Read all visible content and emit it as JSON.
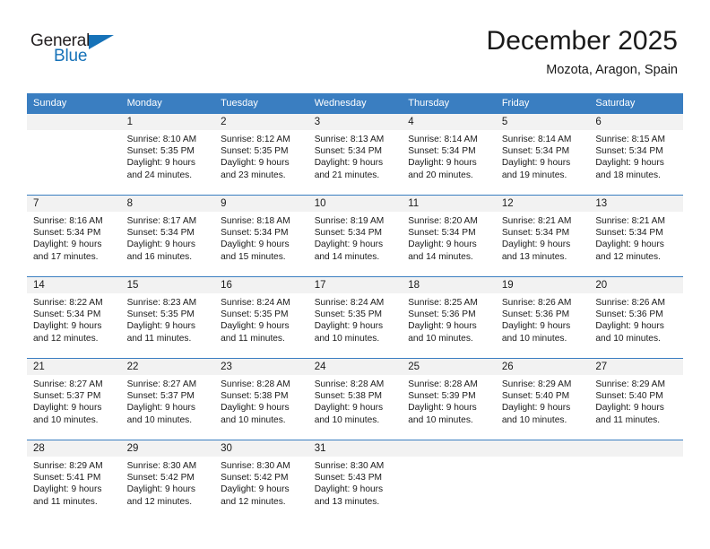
{
  "brand": {
    "name_top": "General",
    "name_bottom": "Blue",
    "triangle_color": "#1672b8"
  },
  "header": {
    "title": "December 2025",
    "subtitle": "Mozota, Aragon, Spain",
    "accent_color": "#3a7ec1",
    "band_color": "#f2f2f2"
  },
  "weekdays": [
    "Sunday",
    "Monday",
    "Tuesday",
    "Wednesday",
    "Thursday",
    "Friday",
    "Saturday"
  ],
  "labels": {
    "sunrise_prefix": "Sunrise:",
    "sunset_prefix": "Sunset:",
    "daylight_prefix": "Daylight:"
  },
  "weeks": [
    [
      {
        "day": "",
        "lines": []
      },
      {
        "day": "1",
        "lines": [
          "Sunrise: 8:10 AM",
          "Sunset: 5:35 PM",
          "Daylight: 9 hours",
          "and 24 minutes."
        ]
      },
      {
        "day": "2",
        "lines": [
          "Sunrise: 8:12 AM",
          "Sunset: 5:35 PM",
          "Daylight: 9 hours",
          "and 23 minutes."
        ]
      },
      {
        "day": "3",
        "lines": [
          "Sunrise: 8:13 AM",
          "Sunset: 5:34 PM",
          "Daylight: 9 hours",
          "and 21 minutes."
        ]
      },
      {
        "day": "4",
        "lines": [
          "Sunrise: 8:14 AM",
          "Sunset: 5:34 PM",
          "Daylight: 9 hours",
          "and 20 minutes."
        ]
      },
      {
        "day": "5",
        "lines": [
          "Sunrise: 8:14 AM",
          "Sunset: 5:34 PM",
          "Daylight: 9 hours",
          "and 19 minutes."
        ]
      },
      {
        "day": "6",
        "lines": [
          "Sunrise: 8:15 AM",
          "Sunset: 5:34 PM",
          "Daylight: 9 hours",
          "and 18 minutes."
        ]
      }
    ],
    [
      {
        "day": "7",
        "lines": [
          "Sunrise: 8:16 AM",
          "Sunset: 5:34 PM",
          "Daylight: 9 hours",
          "and 17 minutes."
        ]
      },
      {
        "day": "8",
        "lines": [
          "Sunrise: 8:17 AM",
          "Sunset: 5:34 PM",
          "Daylight: 9 hours",
          "and 16 minutes."
        ]
      },
      {
        "day": "9",
        "lines": [
          "Sunrise: 8:18 AM",
          "Sunset: 5:34 PM",
          "Daylight: 9 hours",
          "and 15 minutes."
        ]
      },
      {
        "day": "10",
        "lines": [
          "Sunrise: 8:19 AM",
          "Sunset: 5:34 PM",
          "Daylight: 9 hours",
          "and 14 minutes."
        ]
      },
      {
        "day": "11",
        "lines": [
          "Sunrise: 8:20 AM",
          "Sunset: 5:34 PM",
          "Daylight: 9 hours",
          "and 14 minutes."
        ]
      },
      {
        "day": "12",
        "lines": [
          "Sunrise: 8:21 AM",
          "Sunset: 5:34 PM",
          "Daylight: 9 hours",
          "and 13 minutes."
        ]
      },
      {
        "day": "13",
        "lines": [
          "Sunrise: 8:21 AM",
          "Sunset: 5:34 PM",
          "Daylight: 9 hours",
          "and 12 minutes."
        ]
      }
    ],
    [
      {
        "day": "14",
        "lines": [
          "Sunrise: 8:22 AM",
          "Sunset: 5:34 PM",
          "Daylight: 9 hours",
          "and 12 minutes."
        ]
      },
      {
        "day": "15",
        "lines": [
          "Sunrise: 8:23 AM",
          "Sunset: 5:35 PM",
          "Daylight: 9 hours",
          "and 11 minutes."
        ]
      },
      {
        "day": "16",
        "lines": [
          "Sunrise: 8:24 AM",
          "Sunset: 5:35 PM",
          "Daylight: 9 hours",
          "and 11 minutes."
        ]
      },
      {
        "day": "17",
        "lines": [
          "Sunrise: 8:24 AM",
          "Sunset: 5:35 PM",
          "Daylight: 9 hours",
          "and 10 minutes."
        ]
      },
      {
        "day": "18",
        "lines": [
          "Sunrise: 8:25 AM",
          "Sunset: 5:36 PM",
          "Daylight: 9 hours",
          "and 10 minutes."
        ]
      },
      {
        "day": "19",
        "lines": [
          "Sunrise: 8:26 AM",
          "Sunset: 5:36 PM",
          "Daylight: 9 hours",
          "and 10 minutes."
        ]
      },
      {
        "day": "20",
        "lines": [
          "Sunrise: 8:26 AM",
          "Sunset: 5:36 PM",
          "Daylight: 9 hours",
          "and 10 minutes."
        ]
      }
    ],
    [
      {
        "day": "21",
        "lines": [
          "Sunrise: 8:27 AM",
          "Sunset: 5:37 PM",
          "Daylight: 9 hours",
          "and 10 minutes."
        ]
      },
      {
        "day": "22",
        "lines": [
          "Sunrise: 8:27 AM",
          "Sunset: 5:37 PM",
          "Daylight: 9 hours",
          "and 10 minutes."
        ]
      },
      {
        "day": "23",
        "lines": [
          "Sunrise: 8:28 AM",
          "Sunset: 5:38 PM",
          "Daylight: 9 hours",
          "and 10 minutes."
        ]
      },
      {
        "day": "24",
        "lines": [
          "Sunrise: 8:28 AM",
          "Sunset: 5:38 PM",
          "Daylight: 9 hours",
          "and 10 minutes."
        ]
      },
      {
        "day": "25",
        "lines": [
          "Sunrise: 8:28 AM",
          "Sunset: 5:39 PM",
          "Daylight: 9 hours",
          "and 10 minutes."
        ]
      },
      {
        "day": "26",
        "lines": [
          "Sunrise: 8:29 AM",
          "Sunset: 5:40 PM",
          "Daylight: 9 hours",
          "and 10 minutes."
        ]
      },
      {
        "day": "27",
        "lines": [
          "Sunrise: 8:29 AM",
          "Sunset: 5:40 PM",
          "Daylight: 9 hours",
          "and 11 minutes."
        ]
      }
    ],
    [
      {
        "day": "28",
        "lines": [
          "Sunrise: 8:29 AM",
          "Sunset: 5:41 PM",
          "Daylight: 9 hours",
          "and 11 minutes."
        ]
      },
      {
        "day": "29",
        "lines": [
          "Sunrise: 8:30 AM",
          "Sunset: 5:42 PM",
          "Daylight: 9 hours",
          "and 12 minutes."
        ]
      },
      {
        "day": "30",
        "lines": [
          "Sunrise: 8:30 AM",
          "Sunset: 5:42 PM",
          "Daylight: 9 hours",
          "and 12 minutes."
        ]
      },
      {
        "day": "31",
        "lines": [
          "Sunrise: 8:30 AM",
          "Sunset: 5:43 PM",
          "Daylight: 9 hours",
          "and 13 minutes."
        ]
      },
      {
        "day": "",
        "lines": []
      },
      {
        "day": "",
        "lines": []
      },
      {
        "day": "",
        "lines": []
      }
    ]
  ]
}
